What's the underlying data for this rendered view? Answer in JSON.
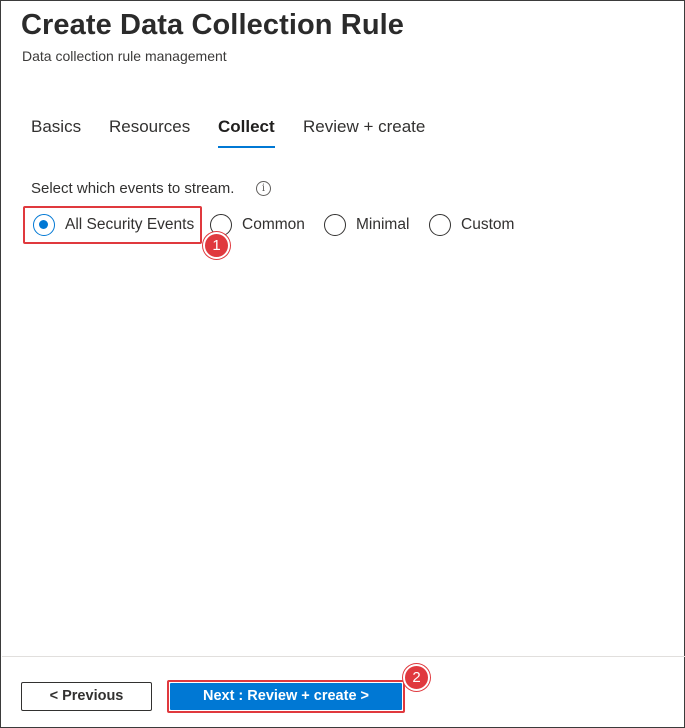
{
  "header": {
    "title": "Create Data Collection Rule",
    "subtitle": "Data collection rule management"
  },
  "tabs": [
    {
      "label": "Basics",
      "active": false
    },
    {
      "label": "Resources",
      "active": false
    },
    {
      "label": "Collect",
      "active": true
    },
    {
      "label": "Review + create",
      "active": false
    }
  ],
  "collect": {
    "question": "Select which events to stream.",
    "info_icon": "info-icon",
    "options": [
      {
        "label": "All Security Events",
        "selected": true
      },
      {
        "label": "Common",
        "selected": false
      },
      {
        "label": "Minimal",
        "selected": false
      },
      {
        "label": "Custom",
        "selected": false
      }
    ]
  },
  "callouts": {
    "step1": "1",
    "step2": "2",
    "color": "#e0393e"
  },
  "footer": {
    "previous_label": "< Previous",
    "next_label": "Next : Review + create >"
  },
  "colors": {
    "accent": "#0078d4",
    "text": "#323130"
  }
}
